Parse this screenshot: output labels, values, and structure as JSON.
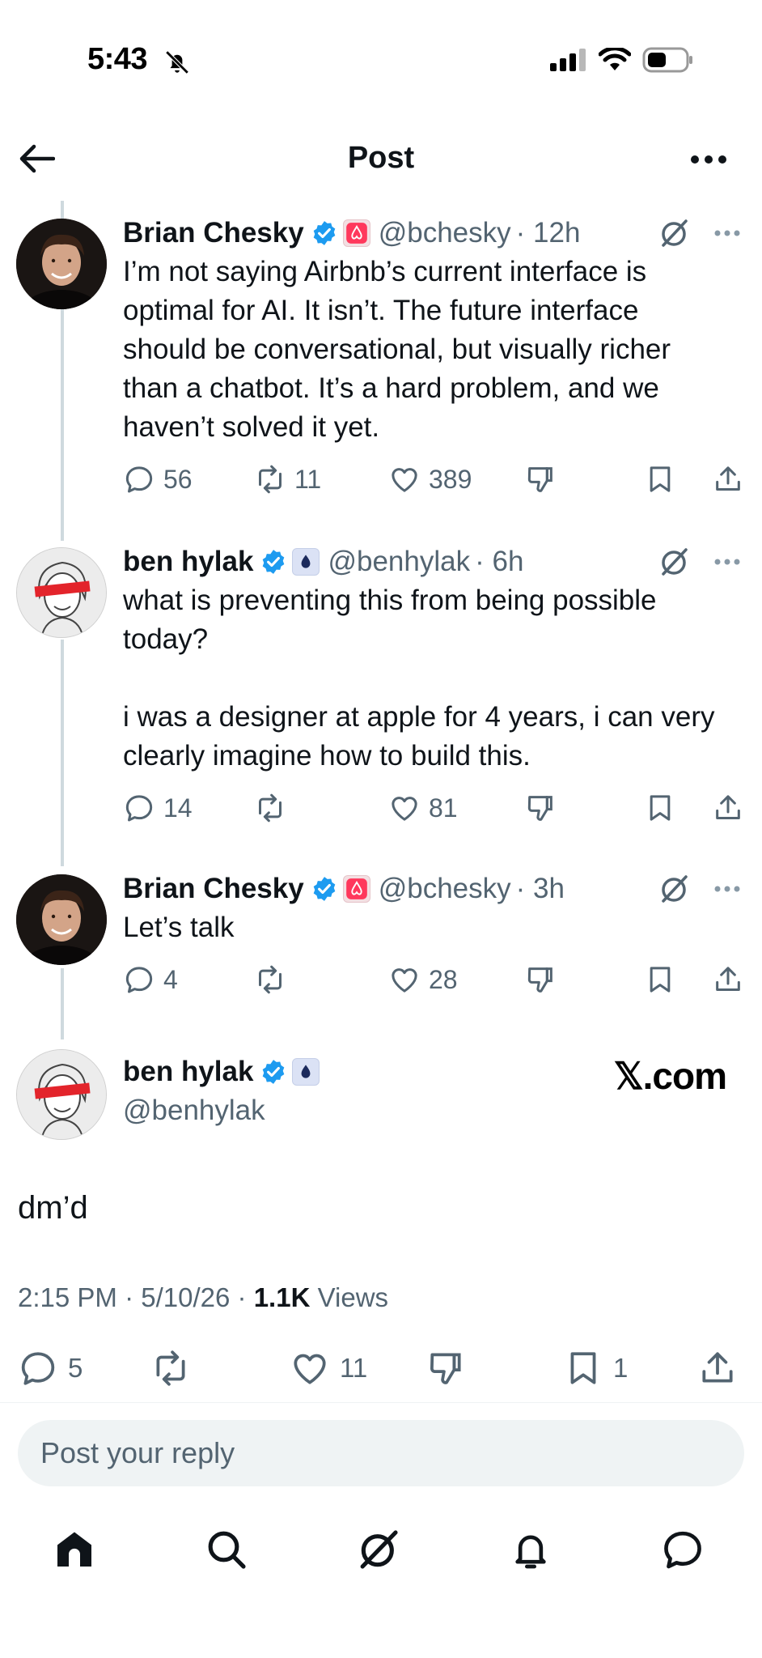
{
  "status_bar": {
    "time": "5:43"
  },
  "header": {
    "title": "Post"
  },
  "posts": [
    {
      "name": "Brian Chesky",
      "handle": "@bchesky",
      "time": "· 12h",
      "text": "I’m not saying Airbnb’s current interface is optimal for AI. It isn’t. The future interface should be conversational, but visually richer than a chatbot. It’s a hard problem, and we haven’t solved it yet.",
      "replies": "56",
      "reposts": "11",
      "likes": "389"
    },
    {
      "name": "ben hylak",
      "handle": "@benhylak",
      "time": "· 6h",
      "text": "what is preventing this from being possible today?\n\ni was a designer at apple for 4 years, i can very clearly imagine how to build this.",
      "replies": "14",
      "reposts": "",
      "likes": "81"
    },
    {
      "name": "Brian Chesky",
      "handle": "@bchesky",
      "time": "· 3h",
      "text": "Let’s talk",
      "replies": "4",
      "reposts": "",
      "likes": "28"
    }
  ],
  "detail": {
    "name": "ben hylak",
    "handle": "@benhylak",
    "watermark": "𝕏.com",
    "text": "dm’d",
    "time": "2:15 PM",
    "date": "5/10/26",
    "views_count": "1.1K",
    "views_label": "Views",
    "replies": "5",
    "reposts": "",
    "likes": "11",
    "bookmarks": "1"
  },
  "reply": {
    "placeholder": "Post your reply"
  },
  "colors": {
    "text": "#0f1419",
    "secondary": "#536471",
    "verified": "#1d9bf0",
    "airbnb": "#ff385c"
  },
  "icons": [
    "back-arrow-icon",
    "more-icon",
    "grok-icon",
    "reply-icon",
    "repost-icon",
    "like-icon",
    "dislike-icon",
    "bookmark-icon",
    "share-icon",
    "home-icon",
    "search-icon",
    "notifications-icon",
    "messages-icon"
  ]
}
